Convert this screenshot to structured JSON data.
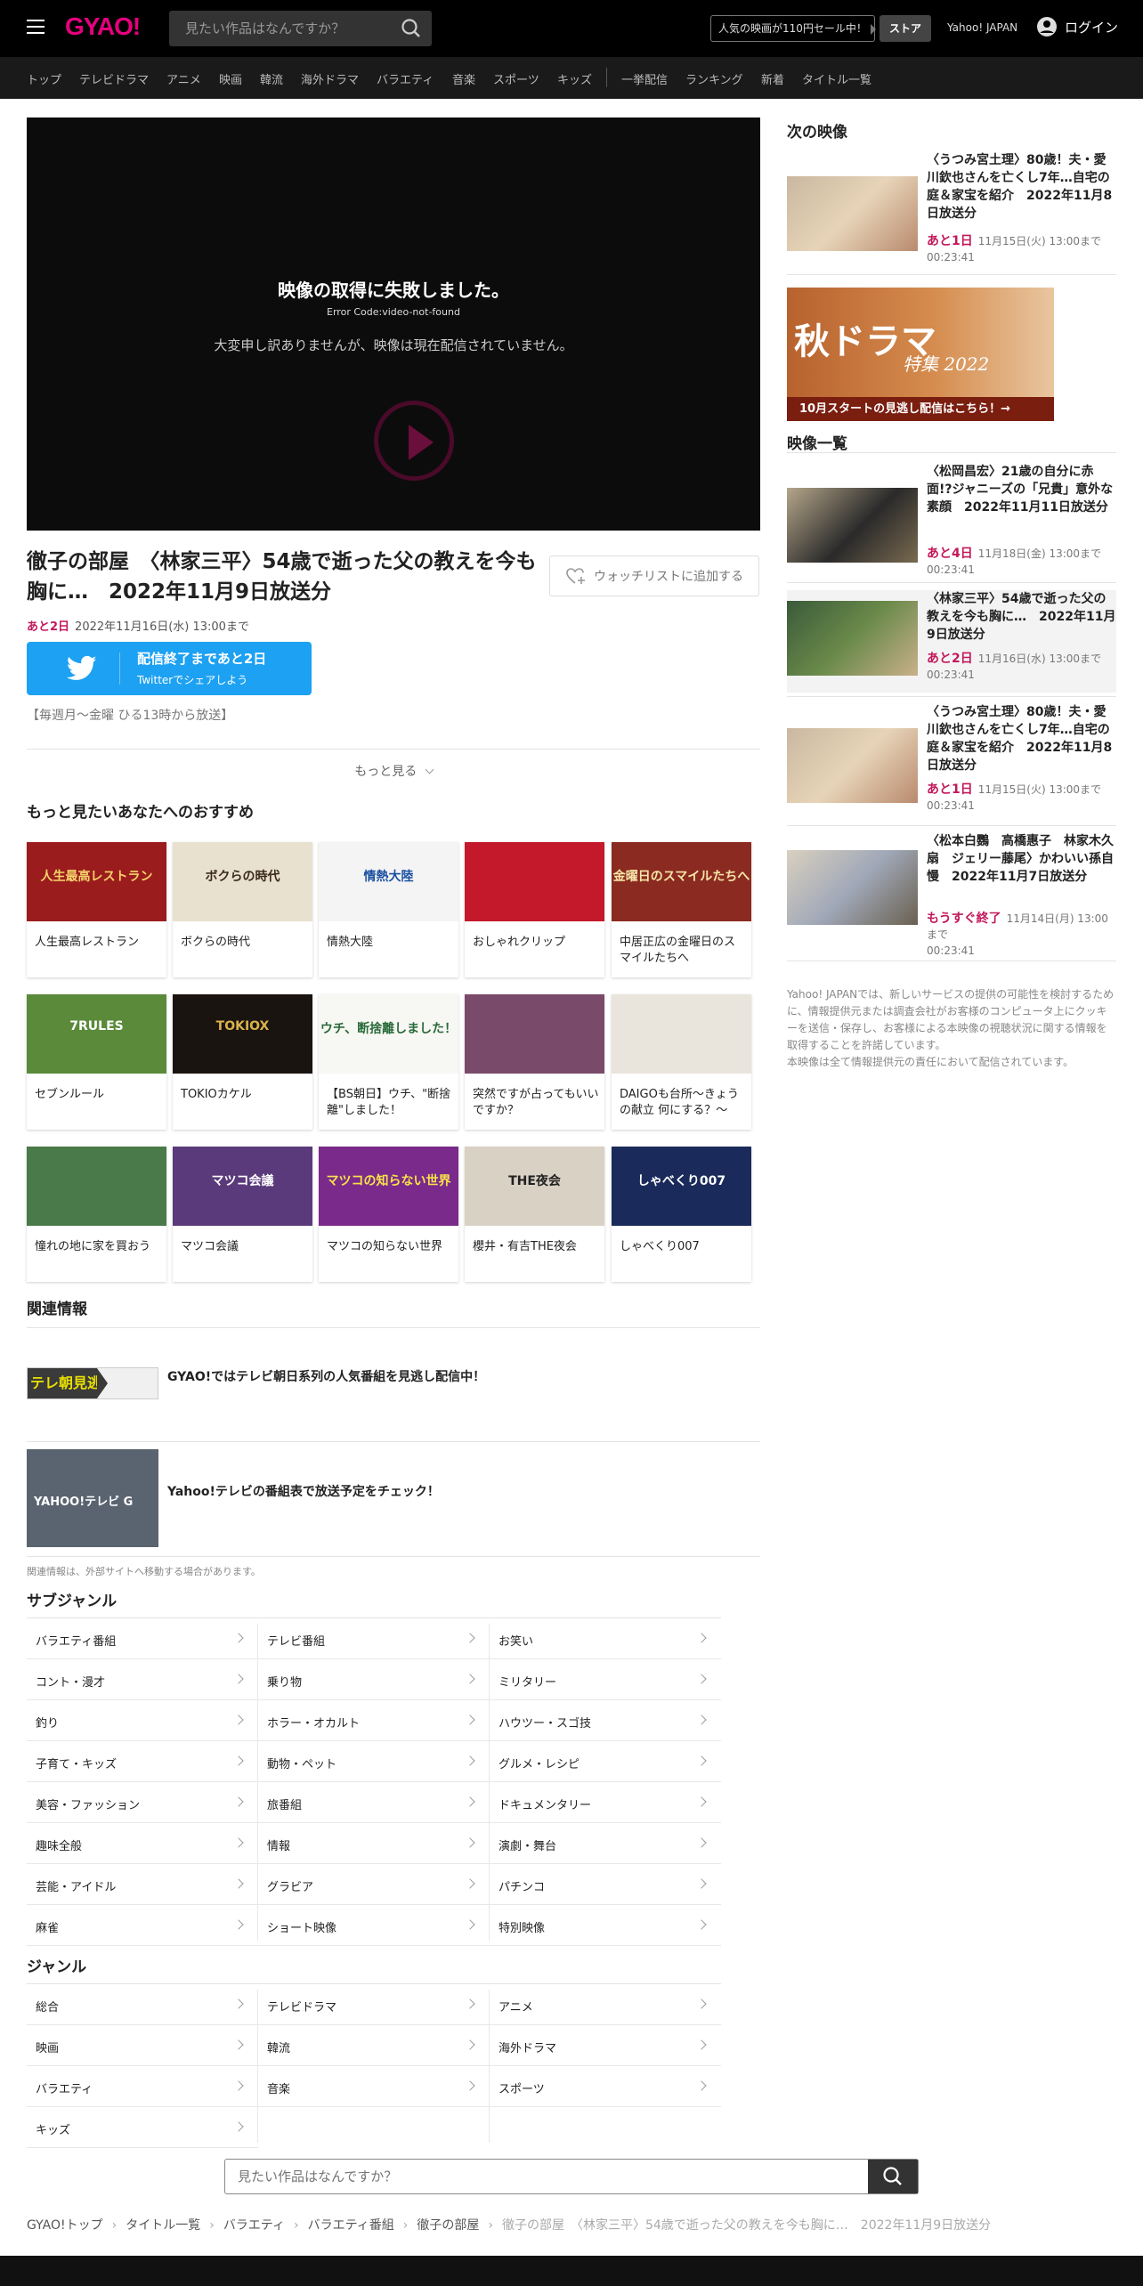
{
  "header": {
    "logo": "GYAO!",
    "search_placeholder": "見たい作品はなんですか？",
    "promo": "人気の映画が110円セール中！",
    "store": "ストア",
    "yahoo": "Yahoo! JAPAN",
    "login": "ログイン"
  },
  "nav": {
    "items": [
      "トップ",
      "テレビドラマ",
      "アニメ",
      "映画",
      "韓流",
      "海外ドラマ",
      "バラエティ",
      "音楽",
      "スポーツ",
      "キッズ",
      "一挙配信",
      "ランキング",
      "新着",
      "タイトル一覧"
    ]
  },
  "player": {
    "error_title": "映像の取得に失敗しました。",
    "error_code": "Error Code:video-not-found",
    "error_message": "大変申し訳ありませんが、映像は現在配信されていません。"
  },
  "episode": {
    "title": "徹子の部屋　〈林家三平〉54歳で逝った父の教えを今も胸に…　2022年11月9日放送分",
    "remaining": "あと2日",
    "until": "2022年11月16日(水) 13:00まで",
    "watchlist": "ウォッチリストに追加する",
    "twitter_line1": "配信終了まであと2日",
    "twitter_line2": "Twitterでシェアしよう",
    "schedule": "【毎週月～金曜 ひる13時から放送】",
    "more": "もっと見る"
  },
  "recommend": {
    "heading": "もっと見たいあなたへのおすすめ",
    "items": [
      {
        "label": "人生最高レストラン",
        "thumb": "人生最高レストラン",
        "bg": "#9b1c1c",
        "fg": "#f5d36b"
      },
      {
        "label": "ボクらの時代",
        "thumb": "ボクらの時代",
        "bg": "#e9e1cf",
        "fg": "#3a2a1a"
      },
      {
        "label": "情熱大陸",
        "thumb": "情熱大陸",
        "bg": "#f4f4f4",
        "fg": "#1a4fa0"
      },
      {
        "label": "おしゃれクリップ",
        "thumb": "",
        "bg": "#c4182b",
        "fg": "#fff"
      },
      {
        "label": "中居正広の金曜日のスマイルたちへ",
        "thumb": "金曜日のスマイルたちへ",
        "bg": "#8a2a20",
        "fg": "#f7e6a8"
      },
      {
        "label": "セブンルール",
        "thumb": "7RULES",
        "bg": "#5a8a3a",
        "fg": "#fff"
      },
      {
        "label": "TOKIOカケル",
        "thumb": "TOKIOX",
        "bg": "#1a1410",
        "fg": "#d9b24a"
      },
      {
        "label": "【BS朝日】ウチ、\"断捨離\"しました！",
        "thumb": "ウチ、断捨離しました！",
        "bg": "#f7f7f3",
        "fg": "#2a6a3a"
      },
      {
        "label": "突然ですが占ってもいいですか？",
        "thumb": "",
        "bg": "#7a4a6a",
        "fg": "#fff"
      },
      {
        "label": "DAIGOも台所～きょうの献立 何にする？～",
        "thumb": "",
        "bg": "#e9e4dc",
        "fg": "#c2185b"
      },
      {
        "label": "憧れの地に家を買おう",
        "thumb": "",
        "bg": "#4a7a4a",
        "fg": "#fff"
      },
      {
        "label": "マツコ会議",
        "thumb": "マツコ会議",
        "bg": "#5a3a7a",
        "fg": "#fff"
      },
      {
        "label": "マツコの知らない世界",
        "thumb": "マツコの知らない世界",
        "bg": "#7a2a8a",
        "fg": "#f7e34a"
      },
      {
        "label": "櫻井・有吉THE夜会",
        "thumb": "THE夜会",
        "bg": "#d9d2c4",
        "fg": "#222"
      },
      {
        "label": "しゃべくり007",
        "thumb": "しゃべくり007",
        "bg": "#1a2a5a",
        "fg": "#fff"
      }
    ]
  },
  "related": {
    "heading": "関連情報",
    "items": [
      {
        "logo": "テレ朝見逃し",
        "text": "GYAO!ではテレビ朝日系列の人気番組を見逃し配信中！"
      },
      {
        "logo": "YAHOO!テレビ G",
        "text": "Yahoo!テレビの番組表で放送予定をチェック！"
      }
    ],
    "note": "関連情報は、外部サイトへ移動する場合があります。"
  },
  "subgenre": {
    "heading": "サブジャンル",
    "items": [
      "バラエティ番組",
      "テレビ番組",
      "お笑い",
      "コント・漫才",
      "乗り物",
      "ミリタリー",
      "釣り",
      "ホラー・オカルト",
      "ハウツー・スゴ技",
      "子育て・キッズ",
      "動物・ペット",
      "グルメ・レシピ",
      "美容・ファッション",
      "旅番組",
      "ドキュメンタリー",
      "趣味全般",
      "情報",
      "演劇・舞台",
      "芸能・アイドル",
      "グラビア",
      "パチンコ",
      "麻雀",
      "ショート映像",
      "特別映像"
    ]
  },
  "genre": {
    "heading": "ジャンル",
    "items": [
      "総合",
      "テレビドラマ",
      "アニメ",
      "映画",
      "韓流",
      "海外ドラマ",
      "バラエティ",
      "音楽",
      "スポーツ",
      "キッズ"
    ]
  },
  "bottom_search": {
    "placeholder": "見たい作品はなんですか？"
  },
  "breadcrumb": [
    "GYAO!トップ",
    "タイトル一覧",
    "バラエティ",
    "バラエティ番組",
    "徹子の部屋",
    "徹子の部屋　〈林家三平〉54歳で逝った父の教えを今も胸に…　2022年11月9日放送分"
  ],
  "sidebar": {
    "next_heading": "次の映像",
    "next": {
      "title": "〈うつみ宮土理〉80歳！夫・愛川欽也さんを亡くし7年…自宅の庭＆家宝を紹介　2022年11月8日放送分",
      "remaining": "あと1日",
      "until": "11月15日(火) 13:00まで",
      "duration": "00:23:41"
    },
    "banner_title": "秋ドラマ",
    "banner_sub": "特集 2022",
    "banner_caption": "10月スタートの見逃し配信はこちら！→",
    "list_heading": "映像一覧",
    "list": [
      {
        "title": "〈松岡昌宏〉21歳の自分に赤面!?ジャニーズの「兄貴」意外な素顔　2022年11月11日放送分",
        "remaining": "あと4日",
        "until": "11月18日(金) 13:00まで",
        "duration": "00:23:41"
      },
      {
        "title": "〈林家三平〉54歳で逝った父の教えを今も胸に…　2022年11月9日放送分",
        "remaining": "あと2日",
        "until": "11月16日(水) 13:00まで",
        "duration": "00:23:41"
      },
      {
        "title": "〈うつみ宮土理〉80歳！夫・愛川欽也さんを亡くし7年…自宅の庭＆家宝を紹介　2022年11月8日放送分",
        "remaining": "あと1日",
        "until": "11月15日(火) 13:00まで",
        "duration": "00:23:41"
      },
      {
        "title": "〈松本白鸚　高橋惠子　林家木久扇　ジェリー藤尾〉かわいい孫自慢　2022年11月7日放送分",
        "remaining": "もうすぐ終了",
        "until": "11月14日(月) 13:00まで",
        "duration": "00:23:41"
      }
    ],
    "disclaimer": "Yahoo! JAPANでは、新しいサービスの提供の可能性を検討するために、情報提供元または調査会社がお客様のコンピュータ上にクッキーを送信・保存し、お客様による本映像の視聴状況に関する情報を取得することを許諾しています。\n本映像は全て情報提供元の責任において配信されています。"
  },
  "colors": {
    "brand": "#e6007e",
    "accent": "#c2185b",
    "twitter": "#1da1f2",
    "header": "#000000",
    "nav": "#1a1a1a"
  }
}
